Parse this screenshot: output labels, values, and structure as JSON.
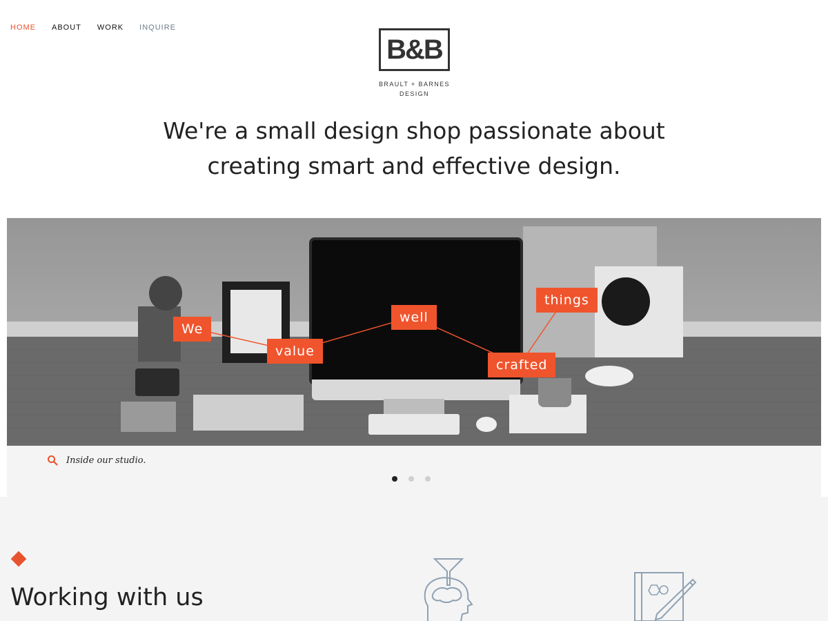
{
  "nav": {
    "items": [
      {
        "label": "HOME",
        "state": "active"
      },
      {
        "label": "ABOUT",
        "state": "normal"
      },
      {
        "label": "WORK",
        "state": "normal"
      },
      {
        "label": "INQUIRE",
        "state": "muted"
      }
    ]
  },
  "logo": {
    "mark": "B&B",
    "line1": "BRAULT + BARNES",
    "line2": "DESIGN"
  },
  "headline": {
    "line1": "We're a small design shop passionate about",
    "line2": "creating smart and effective design."
  },
  "hero": {
    "tags": [
      "We",
      "value",
      "well",
      "crafted",
      "things"
    ],
    "caption": "Inside our studio.",
    "slides": {
      "count": 3,
      "active_index": 0
    }
  },
  "section": {
    "title": "Working with us"
  },
  "colors": {
    "accent": "#f0542d",
    "nav_active": "#e8522d",
    "nav_muted": "#6d7a86",
    "panel_bg": "#f4f4f4",
    "icon_stroke": "#8ea1b3"
  },
  "icons": [
    "search-icon",
    "diamond-icon",
    "funnel-head-icon",
    "notebook-pencil-icon"
  ]
}
